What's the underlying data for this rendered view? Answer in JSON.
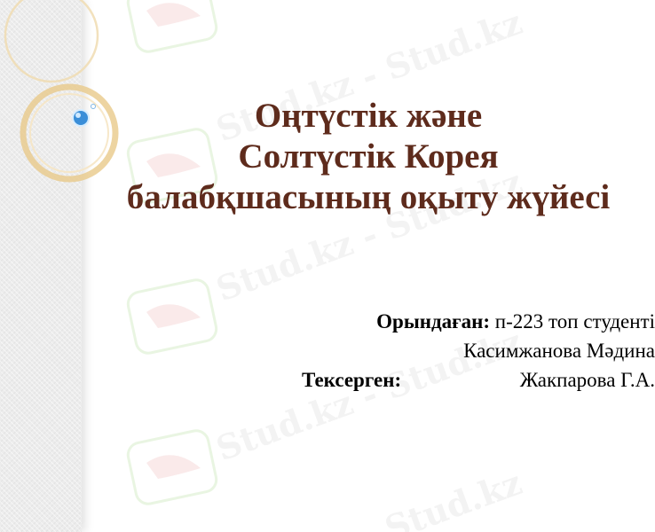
{
  "slide": {
    "title_lines": [
      "Оңтүстік және",
      "Солтүстік Корея",
      "балабқшасының оқыту жүйесі"
    ],
    "performed_by_label": "Орындаған:",
    "performed_by_value": "п-223 топ студенті",
    "student_name": "Касимжанова Мәдина",
    "checked_by_label": "Тексерген:",
    "checked_by_value": "Жакпарова Г.А."
  },
  "watermark": {
    "text": "Stud.kz - Stud.kz"
  },
  "colors": {
    "title": "#5e2b1c",
    "ring_gold": "#e8c98a",
    "bead_blue": "#3a8ed8"
  }
}
